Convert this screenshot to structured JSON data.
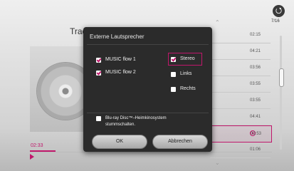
{
  "player": {
    "track_title": "Track",
    "elapsed_time": "02:33"
  },
  "header": {
    "back_icon": "⭯",
    "page_indicator": "7/16"
  },
  "playlist": {
    "times": [
      "02:15",
      "04:21",
      "03:56",
      "03:55",
      "03:55",
      "04:41",
      "03:53",
      "01:06"
    ],
    "active_index": 6
  },
  "dialog": {
    "title": "Externe Lautsprecher",
    "options": [
      {
        "label": "MUSIC flow 1",
        "checked": true
      },
      {
        "label": "MUSIC flow 2",
        "checked": true
      },
      {
        "label": "Stereo",
        "checked": true
      },
      {
        "label": "Links",
        "checked": false
      },
      {
        "label": "Rechts",
        "checked": false
      }
    ],
    "mute_option": {
      "label_line1": "Blu-ray Disc™–Heimkinosystem",
      "label_line2": "stummschalten.",
      "checked": false
    },
    "ok_label": "OK",
    "cancel_label": "Abbrechen"
  },
  "colors": {
    "accent": "#c0176b",
    "dialog_bg": "#2b2b2b"
  }
}
